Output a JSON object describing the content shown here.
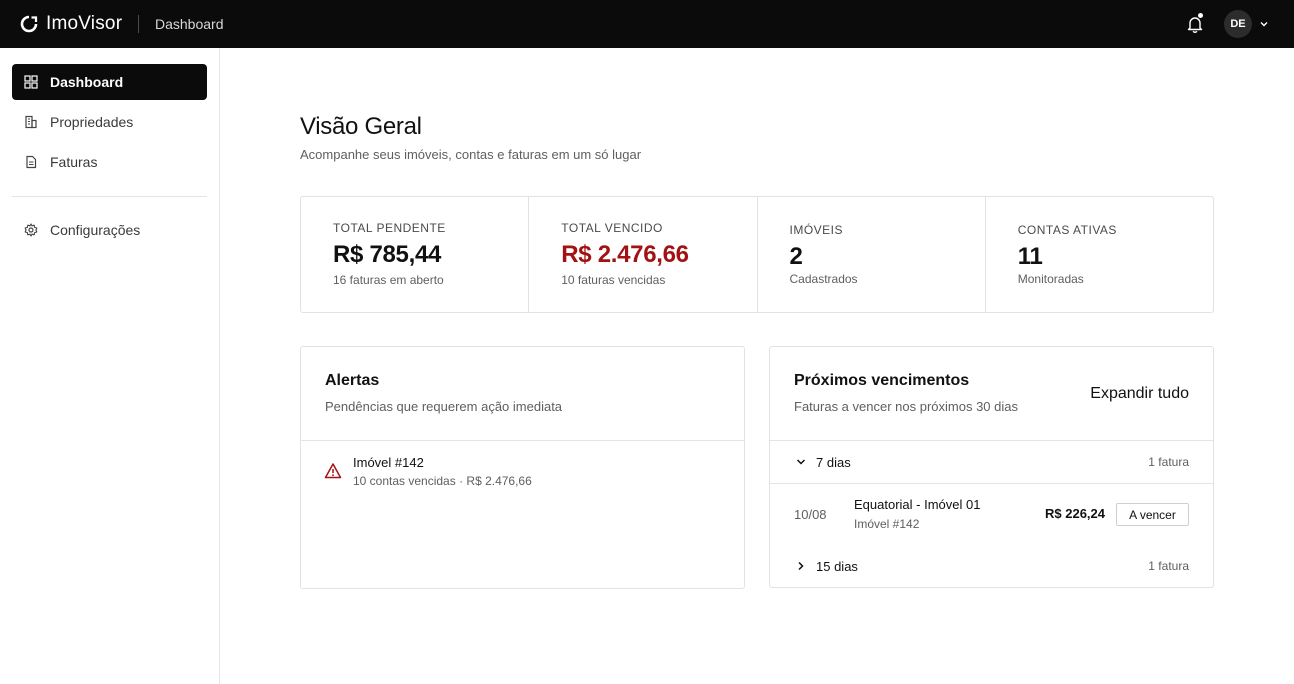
{
  "app": {
    "name": "ImoVisor",
    "breadcrumb": "Dashboard"
  },
  "user": {
    "initials": "DE"
  },
  "sidebar": {
    "items": [
      {
        "label": "Dashboard",
        "icon": "grid-icon",
        "active": true
      },
      {
        "label": "Propriedades",
        "icon": "building-icon",
        "active": false
      },
      {
        "label": "Faturas",
        "icon": "document-icon",
        "active": false
      }
    ],
    "settings": {
      "label": "Configurações",
      "icon": "gear-icon"
    }
  },
  "page": {
    "title": "Visão Geral",
    "subtitle": "Acompanhe seus imóveis, contas e faturas em um só lugar"
  },
  "stats": [
    {
      "label": "TOTAL PENDENTE",
      "value": "R$ 785,44",
      "note": "16 faturas em aberto"
    },
    {
      "label": "TOTAL VENCIDO",
      "value": "R$ 2.476,66",
      "note": "10 faturas vencidas"
    },
    {
      "label": "IMÓVEIS",
      "value": "2",
      "note": "Cadastrados"
    },
    {
      "label": "CONTAS ATIVAS",
      "value": "11",
      "note": "Monitoradas"
    }
  ],
  "alerts": {
    "title": "Alertas",
    "subtitle": "Pendências que requerem ação imediata",
    "items": [
      {
        "title": "Imóvel #142",
        "detail": "10 contas vencidas · R$ 2.476,66"
      }
    ]
  },
  "upcoming": {
    "title": "Próximos vencimentos",
    "subtitle": "Faturas a vencer nos próximos 30 dias",
    "expand_label": "Expandir tudo",
    "groups": [
      {
        "label": "7 dias",
        "count": "1 fatura",
        "expanded": true,
        "invoices": [
          {
            "date": "10/08",
            "name": "Equatorial - Imóvel 01",
            "property": "Imóvel #142",
            "amount": "R$ 226,24",
            "status": "A vencer"
          }
        ]
      },
      {
        "label": "15 dias",
        "count": "1 fatura",
        "expanded": false
      }
    ]
  },
  "colors": {
    "topbar": "#0b0b0b",
    "danger": "#a31212",
    "border": "#e2e2e2",
    "muted": "#5f5f5f"
  }
}
